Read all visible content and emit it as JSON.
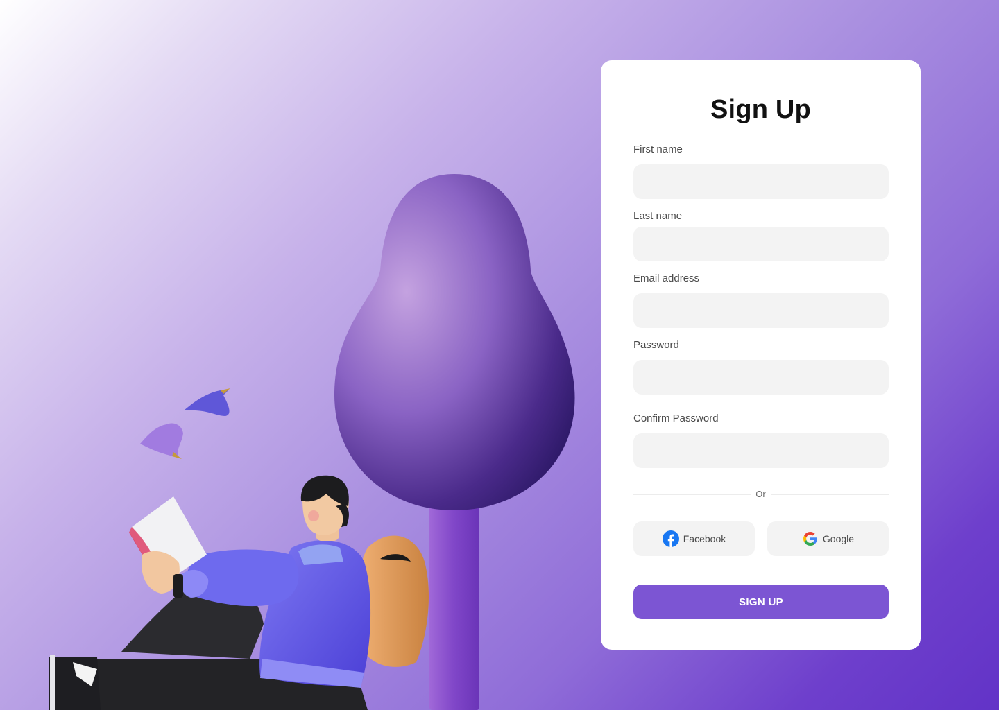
{
  "form": {
    "title": "Sign Up",
    "fields": [
      {
        "label": "First name",
        "value": "",
        "placeholder": ""
      },
      {
        "label": "Last name",
        "value": "",
        "placeholder": ""
      },
      {
        "label": "Email address",
        "value": "",
        "placeholder": ""
      },
      {
        "label": "Password",
        "value": "",
        "placeholder": ""
      },
      {
        "label": "Confirm Password",
        "value": "",
        "placeholder": ""
      }
    ],
    "divider_text": "Or",
    "social": [
      {
        "label": "Facebook",
        "icon": "facebook-icon"
      },
      {
        "label": "Google",
        "icon": "google-icon"
      }
    ],
    "submit_label": "SIGN UP"
  },
  "colors": {
    "accent": "#7c55d3",
    "input_bg": "#f3f3f3",
    "background_start": "#ffffff",
    "background_end": "#6233c7"
  },
  "illustration": {
    "icons": [
      "tree-illustration",
      "person-reading-illustration",
      "bird-icon",
      "bird-icon",
      "backpack-illustration",
      "book-illustration"
    ]
  }
}
